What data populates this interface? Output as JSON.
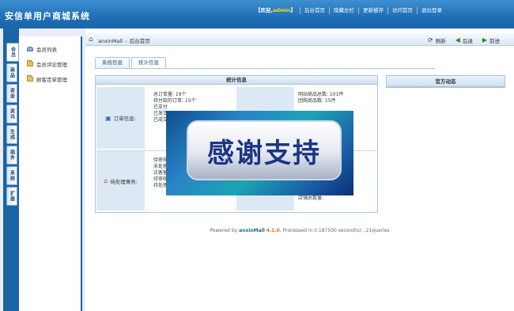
{
  "app": {
    "title": "安信单用户商城系统"
  },
  "topnav": {
    "welcome_prefix": "【欢迎,",
    "username": "admin",
    "welcome_suffix": "】",
    "items": [
      "后台首页",
      "隐藏左栏",
      "更新缓存",
      "访问首页",
      "退出登录"
    ]
  },
  "left_tabs": [
    "会员",
    "商品",
    "资金",
    "资讯",
    "生成",
    "插件",
    "系统",
    "扩展"
  ],
  "sidebar": {
    "items": [
      {
        "label": "会员列表",
        "icon": "person-icon"
      },
      {
        "label": "会员评论管理",
        "icon": "folder-icon"
      },
      {
        "label": "顾客定单管理",
        "icon": "folder-icon"
      }
    ]
  },
  "breadcrumb": {
    "root": "anxinMall",
    "current": "后台首页"
  },
  "actions": {
    "refresh": "刷新",
    "back": "后退",
    "forward": "前进"
  },
  "tabs": [
    "系统信息",
    "统计信息"
  ],
  "stats": {
    "title": "统计信息",
    "order_label": "订单信息:",
    "order_lines": [
      "总订单量: 19个",
      "待付款的订单: 15个",
      "已支付",
      "已发货",
      "已成交"
    ],
    "goods_lines": [
      "网站商品总数: 101件",
      "团购商品数: 15件"
    ],
    "pending_label": "待处理事务:",
    "pending_lines": [
      "待审核",
      "未处理",
      "访客留",
      "待审核",
      "待处理"
    ],
    "shop_line": "店铺总数量:"
  },
  "news": {
    "title": "官方动态"
  },
  "footer": {
    "prefix": "Powered by ",
    "brand": "anxinMall",
    "version": "4.1.0",
    "suffix": ", Processed in 0.187500 second(s) , 21queries"
  },
  "overlay": {
    "text": "感谢支持"
  }
}
